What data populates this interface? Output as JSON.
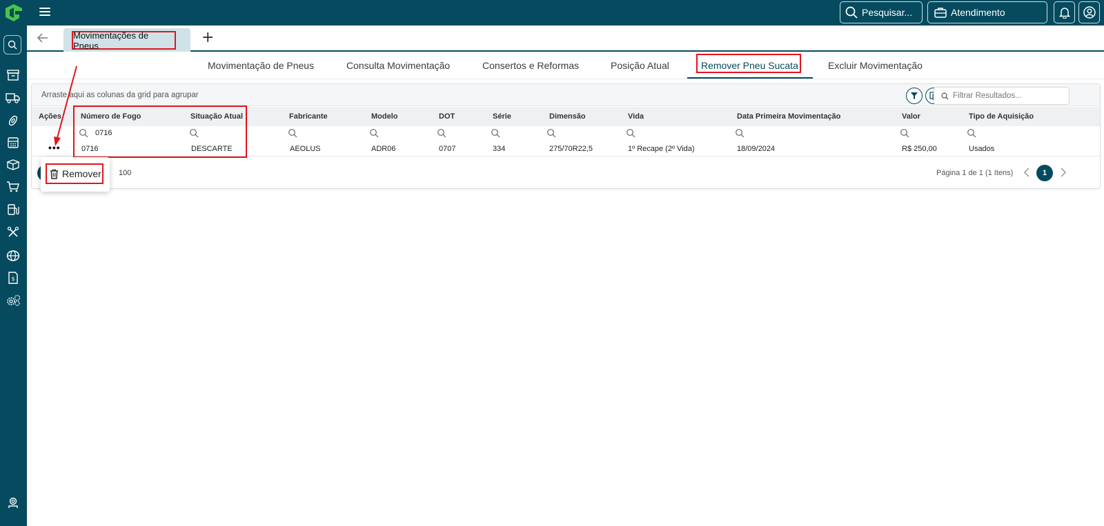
{
  "topbar": {
    "search_label": "Pesquisar...",
    "atendimento_label": "Atendimento"
  },
  "tabs": {
    "document_tab": "Movimentações de Pneus",
    "add_tab": "+"
  },
  "subtabs": [
    {
      "label": "Movimentação de Pneus"
    },
    {
      "label": "Consulta Movimentação"
    },
    {
      "label": "Consertos e Reformas"
    },
    {
      "label": "Posição Atual"
    },
    {
      "label": "Remover Pneu Sucata",
      "active": true
    },
    {
      "label": "Excluir Movimentação"
    }
  ],
  "grid": {
    "group_hint": "Arraste aqui as colunas da grid para agrupar",
    "filter_placeholder": "Filtrar Resultados...",
    "columns": [
      "Ações",
      "Número de Fogo",
      "Situação Atual",
      "Fabricante",
      "Modelo",
      "DOT",
      "Série",
      "Dimensão",
      "Vida",
      "Data Primeira Movimentação",
      "Valor",
      "Tipo de Aquisição"
    ],
    "filter_value": "0716",
    "row": {
      "numero_fogo": "0716",
      "situacao": "DESCARTE",
      "fabricante": "AEOLUS",
      "modelo": "ADR06",
      "dot": "0707",
      "serie": "334",
      "dimensao": "275/70R22,5",
      "vida": "1º Recape (2º Vida)",
      "data": "18/09/2024",
      "valor": "R$ 250,00",
      "tipo": "Usados"
    },
    "page_size": "100",
    "page_info": "Página 1 de 1 (1 Itens)",
    "current_page": "1"
  },
  "context_menu": {
    "remove_label": "Remover"
  },
  "colors": {
    "primary": "#054a5e",
    "highlight": "#e1141c",
    "tab_bg": "#cfe2e8"
  }
}
